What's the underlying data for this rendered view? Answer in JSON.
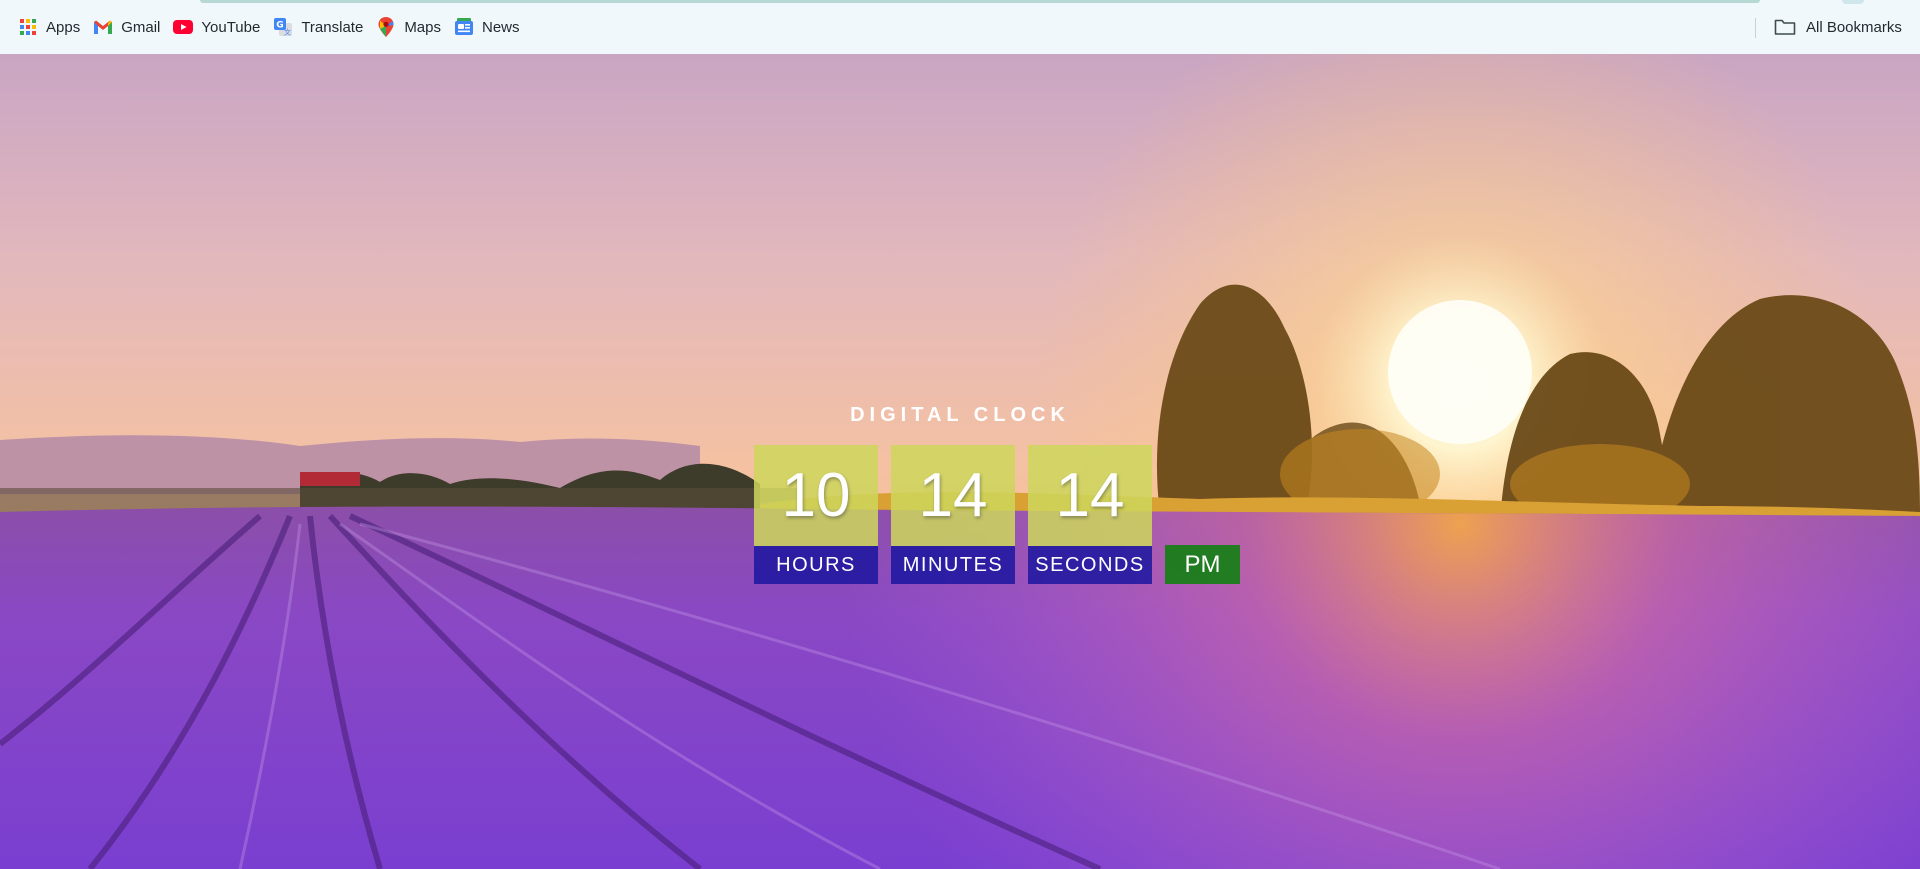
{
  "bookmarks": {
    "items": [
      {
        "label": "Apps",
        "icon": "apps-grid-icon"
      },
      {
        "label": "Gmail",
        "icon": "gmail-icon"
      },
      {
        "label": "YouTube",
        "icon": "youtube-icon"
      },
      {
        "label": "Translate",
        "icon": "translate-icon"
      },
      {
        "label": "Maps",
        "icon": "maps-icon"
      },
      {
        "label": "News",
        "icon": "news-icon"
      }
    ],
    "all_bookmarks_label": "All Bookmarks",
    "all_bookmarks_icon": "folder-icon"
  },
  "clock": {
    "title": "DIGITAL CLOCK",
    "hours": "10",
    "minutes": "14",
    "seconds": "14",
    "hours_label": "HOURS",
    "minutes_label": "MINUTES",
    "seconds_label": "SECONDS",
    "period": "PM"
  },
  "colors": {
    "digits_bg": "#cdd65c",
    "labels_bg": "#1c16a0",
    "period_bg": "#128012",
    "toolbar_bg": "#f1f8fb"
  }
}
